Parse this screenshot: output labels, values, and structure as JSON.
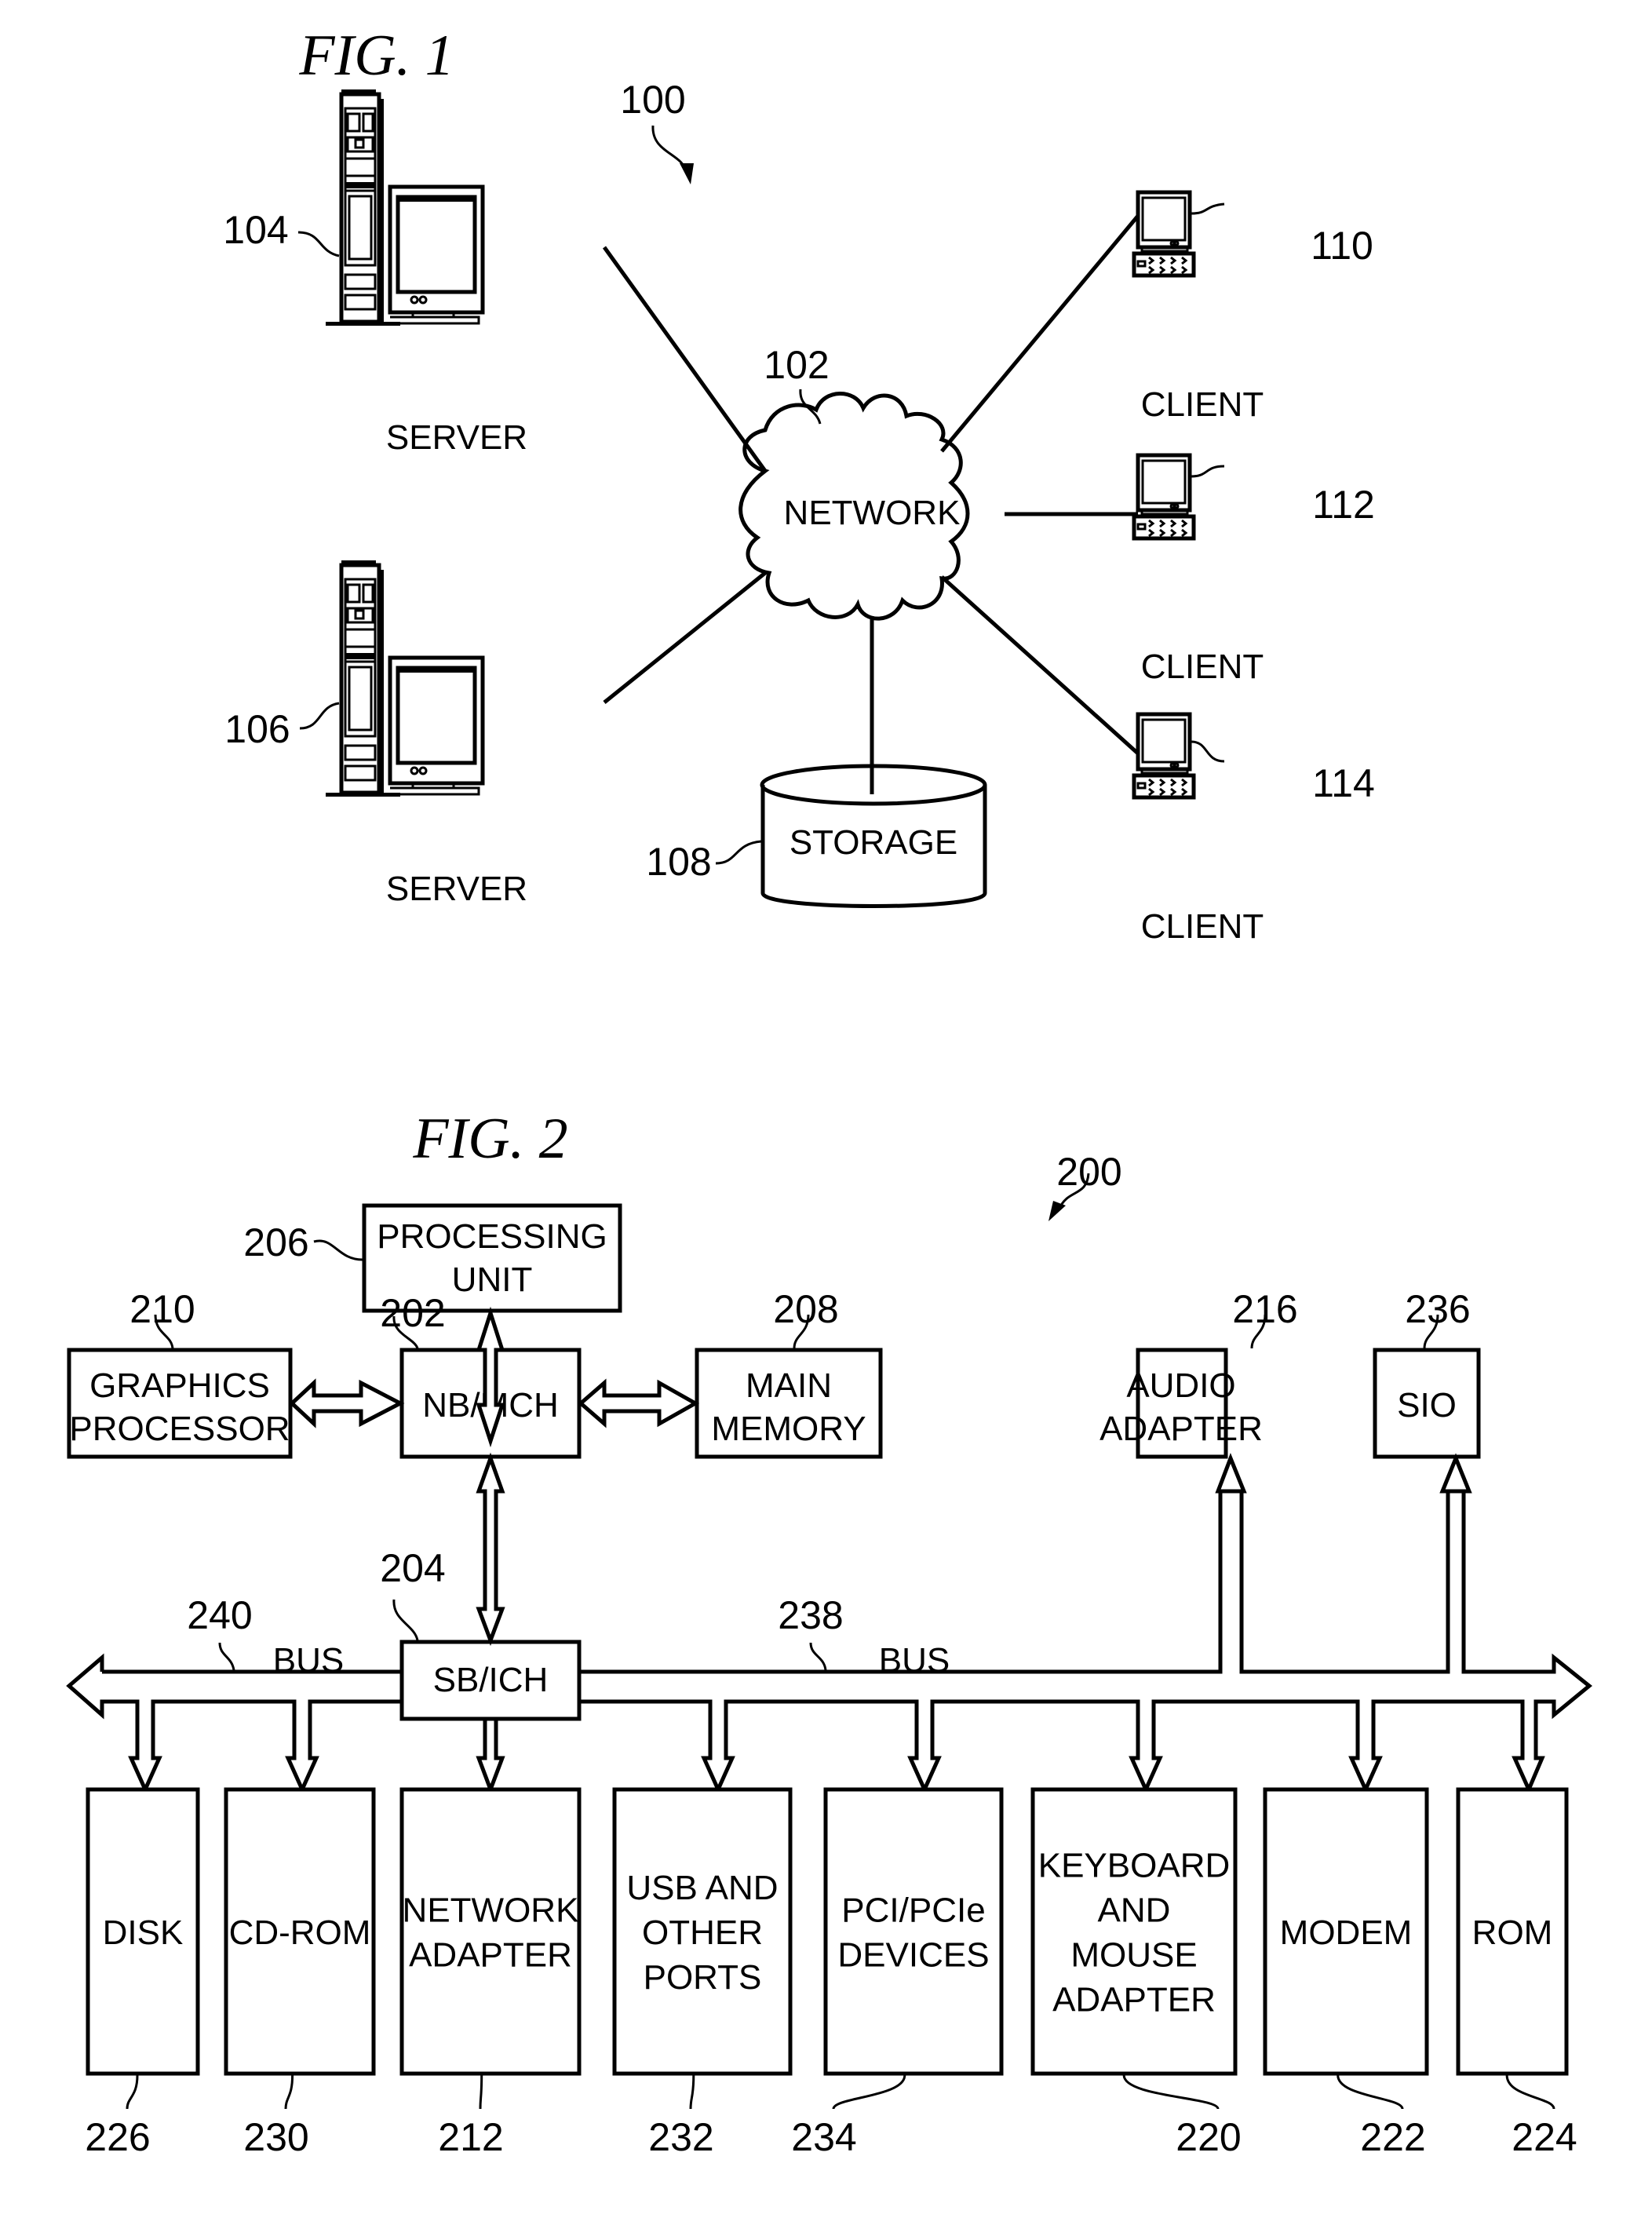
{
  "fig1": {
    "title": "FIG. 1",
    "system_ref": "100",
    "network": {
      "ref": "102",
      "label": "NETWORK"
    },
    "servers": [
      {
        "ref": "104",
        "label": "SERVER"
      },
      {
        "ref": "106",
        "label": "SERVER"
      }
    ],
    "storage": {
      "ref": "108",
      "label": "STORAGE"
    },
    "clients": [
      {
        "ref": "110",
        "label": "CLIENT"
      },
      {
        "ref": "112",
        "label": "CLIENT"
      },
      {
        "ref": "114",
        "label": "CLIENT"
      }
    ]
  },
  "fig2": {
    "title": "FIG. 2",
    "system_ref": "200",
    "processing_unit": {
      "ref": "206",
      "lines": [
        "PROCESSING",
        "UNIT"
      ]
    },
    "nb_mch": {
      "ref": "202",
      "lines": [
        "NB/MCH"
      ]
    },
    "graphics": {
      "ref": "210",
      "lines": [
        "GRAPHICS",
        "PROCESSOR"
      ]
    },
    "main_memory": {
      "ref": "208",
      "lines": [
        "MAIN",
        "MEMORY"
      ]
    },
    "audio": {
      "ref": "216",
      "lines": [
        "AUDIO",
        "ADAPTER"
      ]
    },
    "sio": {
      "ref": "236",
      "lines": [
        "SIO"
      ]
    },
    "sb_ich": {
      "ref": "204",
      "lines": [
        "SB/ICH"
      ]
    },
    "bus_left": {
      "ref": "240",
      "label": "BUS"
    },
    "bus_right": {
      "ref": "238",
      "label": "BUS"
    },
    "devices": [
      {
        "ref": "226",
        "lines": [
          "DISK"
        ]
      },
      {
        "ref": "230",
        "lines": [
          "CD-ROM"
        ]
      },
      {
        "ref": "212",
        "lines": [
          "NETWORK",
          "ADAPTER"
        ]
      },
      {
        "ref": "232",
        "lines": [
          "USB AND",
          "OTHER",
          "PORTS"
        ]
      },
      {
        "ref": "234",
        "lines": [
          "PCI/PCIe",
          "DEVICES"
        ]
      },
      {
        "ref": "220",
        "lines": [
          "KEYBOARD",
          "AND",
          "MOUSE",
          "ADAPTER"
        ]
      },
      {
        "ref": "222",
        "lines": [
          "MODEM"
        ]
      },
      {
        "ref": "224",
        "lines": [
          "ROM"
        ]
      }
    ]
  }
}
